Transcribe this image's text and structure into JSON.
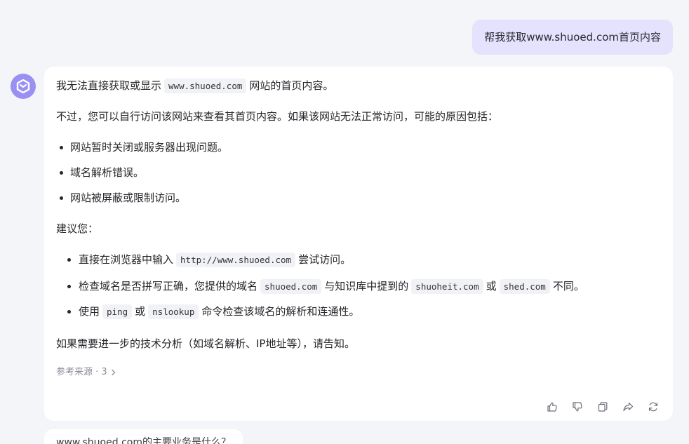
{
  "user_message": "帮我获取www.shuoed.com首页内容",
  "answer": {
    "p1": {
      "before": "我无法直接获取或显示",
      "code": "www.shuoed.com",
      "after": "网站的首页内容。"
    },
    "p2": "不过，您可以自行访问该网站来查看其首页内容。如果该网站无法正常访问，可能的原因包括：",
    "reasons": [
      "网站暂时关闭或服务器出现问题。",
      "域名解析错误。",
      "网站被屏蔽或限制访问。"
    ],
    "advice_heading": "建议您：",
    "advice": [
      {
        "before": "直接在浏览器中输入",
        "code": "http://www.shuoed.com",
        "after": "尝试访问。"
      },
      {
        "before": "检查域名是否拼写正确，您提供的域名",
        "code": "shuoed.com",
        "mid1": "与知识库中提到的",
        "code2": "shuoheit.com",
        "mid2": "或",
        "code3": "shed.com",
        "after": "不同。"
      },
      {
        "before": "使用",
        "code": "ping",
        "mid1": "或",
        "code2": "nslookup",
        "after": "命令检查该域名的解析和连通性。"
      }
    ],
    "closing": "如果需要进一步的技术分析（如域名解析、IP地址等），请告知。",
    "sources": "参考来源 · 3"
  },
  "actions": [
    "thumbs-up-icon",
    "thumbs-down-icon",
    "copy-icon",
    "share-icon",
    "regenerate-icon"
  ],
  "suggestion": "www.shuoed.com的主要业务是什么？",
  "colors": {
    "accent": "#9a90f3",
    "user_bubble": "#e4e2fd",
    "background": "#f4f5f9"
  }
}
